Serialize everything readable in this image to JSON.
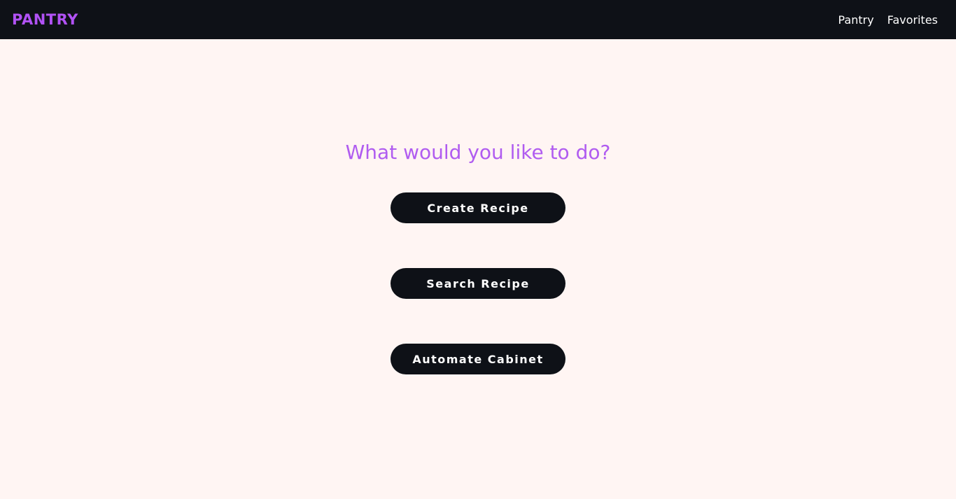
{
  "navbar": {
    "logo": "PANTRY",
    "links": [
      "Pantry",
      "Favorites"
    ]
  },
  "main": {
    "heading": "What would you like to do?",
    "actions": [
      "Create Recipe",
      "Search Recipe",
      "Automate Cabinet"
    ]
  },
  "colors": {
    "background": "#fff5f3",
    "navbar": "#0e1117",
    "accent": "#b152f5",
    "button": "#0e1117",
    "button_text": "#ffffff"
  }
}
